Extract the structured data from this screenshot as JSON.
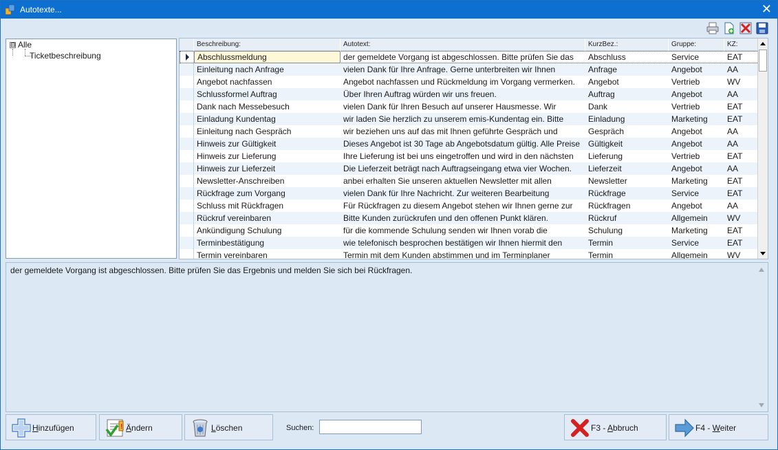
{
  "window": {
    "title": "Autotexte...",
    "close_glyph": "✕"
  },
  "toolbar": {
    "icons": [
      "printer-icon",
      "new-document-icon",
      "delete-icon",
      "save-icon"
    ]
  },
  "tree": {
    "items": [
      {
        "label": "Alle",
        "expander": "⊟",
        "level": 0
      },
      {
        "label": "Ticketbeschreibung",
        "level": 1
      }
    ]
  },
  "grid": {
    "columns": [
      "Beschreibung:",
      "Autotext:",
      "KurzBez.:",
      "Gruppe:",
      "KZ:"
    ],
    "rows": [
      [
        "Abschlussmeldung",
        "der gemeldete Vorgang ist abgeschlossen. Bitte prüfen Sie das",
        "Abschluss",
        "Service",
        "EAT"
      ],
      [
        "Einleitung nach Anfrage",
        "vielen Dank für Ihre Anfrage. Gerne unterbreiten wir Ihnen",
        "Anfrage",
        "Angebot",
        "AA"
      ],
      [
        "Angebot nachfassen",
        "Angebot nachfassen und Rückmeldung im Vorgang vermerken.",
        "Angebot",
        "Vertrieb",
        "WV"
      ],
      [
        "Schlussformel Auftrag",
        "Über Ihren Auftrag würden wir uns freuen.",
        "Auftrag",
        "Angebot",
        "AA"
      ],
      [
        "Dank nach Messebesuch",
        "vielen Dank für Ihren Besuch auf unserer Hausmesse. Wir",
        "Dank",
        "Vertrieb",
        "EAT"
      ],
      [
        "Einladung Kundentag",
        "wir laden Sie herzlich zu unserem emis-Kundentag ein. Bitte",
        "Einladung",
        "Marketing",
        "EAT"
      ],
      [
        "Einleitung nach Gespräch",
        "wir beziehen uns auf das mit Ihnen geführte Gespräch und",
        "Gespräch",
        "Angebot",
        "AA"
      ],
      [
        "Hinweis zur Gültigkeit",
        "Dieses Angebot ist 30 Tage ab Angebotsdatum gültig. Alle Preise",
        "Gültigkeit",
        "Angebot",
        "AA"
      ],
      [
        "Hinweis zur Lieferung",
        "Ihre Lieferung ist bei uns eingetroffen und wird in den nächsten",
        "Lieferung",
        "Vertrieb",
        "EAT"
      ],
      [
        "Hinweis zur Lieferzeit",
        "Die Lieferzeit beträgt nach Auftragseingang etwa vier Wochen.",
        "Lieferzeit",
        "Angebot",
        "AA"
      ],
      [
        "Newsletter-Anschreiben",
        "anbei erhalten Sie unseren aktuellen Newsletter mit allen",
        "Newsletter",
        "Marketing",
        "EAT"
      ],
      [
        "Rückfrage zum Vorgang",
        "vielen Dank für Ihre Nachricht. Zur weiteren Bearbeitung",
        "Rückfrage",
        "Service",
        "EAT"
      ],
      [
        "Schluss mit Rückfragen",
        "Für Rückfragen zu diesem Angebot stehen wir Ihnen gerne zur",
        "Rückfragen",
        "Angebot",
        "AA"
      ],
      [
        "Rückruf vereinbaren",
        "Bitte Kunden zurückrufen und den offenen Punkt klären.",
        "Rückruf",
        "Allgemein",
        "WV"
      ],
      [
        "Ankündigung Schulung",
        "für die kommende Schulung senden wir Ihnen vorab die",
        "Schulung",
        "Marketing",
        "EAT"
      ],
      [
        "Terminbestätigung",
        "wie telefonisch besprochen bestätigen wir Ihnen hiermit den",
        "Termin",
        "Service",
        "EAT"
      ],
      [
        "Termin vereinbaren",
        "Termin mit dem Kunden abstimmen und im Terminplaner",
        "Termin",
        "Allgemein",
        "WV"
      ]
    ],
    "selected_row": 0
  },
  "memo": {
    "text": "der gemeldete Vorgang ist abgeschlossen. Bitte prüfen Sie das Ergebnis und melden Sie sich bei Rückfragen."
  },
  "buttons": {
    "add": {
      "hotkey": "H",
      "rest": "inzufügen"
    },
    "edit": {
      "hotkey": "Ä",
      "rest": "ndern"
    },
    "delete": {
      "hotkey": "L",
      "rest": "öschen"
    },
    "cancel": {
      "prefix": "F3 - ",
      "hotkey": "A",
      "rest": "bbruch"
    },
    "next": {
      "prefix": "F4 - ",
      "hotkey": "W",
      "rest": "eiter"
    }
  },
  "search": {
    "label": "Suchen:",
    "value": ""
  }
}
